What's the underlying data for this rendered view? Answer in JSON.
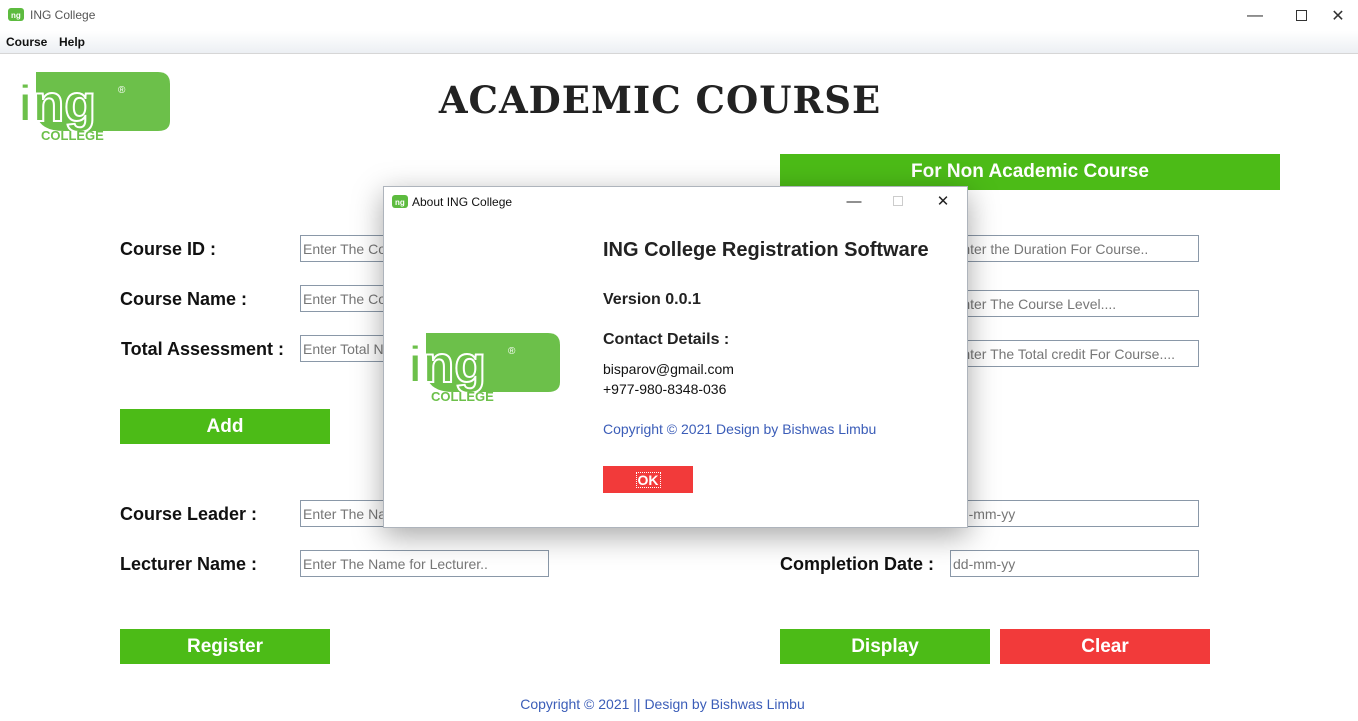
{
  "window": {
    "title": "ING College",
    "icon": "app-icon"
  },
  "menu": {
    "items": [
      "Course",
      "Help"
    ]
  },
  "logo": {
    "text": "ing",
    "subtext": "COLLEGE",
    "mark": "®",
    "color": "#6cc04a"
  },
  "main": {
    "title": "ACADEMIC COURSE",
    "non_academic_banner": "For Non Academic Course"
  },
  "form": {
    "course_id_label": "Course ID :",
    "course_id_placeholder": "Enter The Course ID..",
    "course_name_label": "Course Name :",
    "course_name_placeholder": "Enter The Course Name..",
    "total_assessment_label": "Total Assessment :",
    "total_assessment_placeholder": "Enter Total No. of Assessment..",
    "duration_placeholder": "Enter the Duration For Course..",
    "level_placeholder": "Enter The Course Level....",
    "credit_placeholder": "Enter The Total credit For Course....",
    "add_label": "Add",
    "course_leader_label": "Course Leader :",
    "course_leader_placeholder": "Enter The Name for Course Leader..",
    "lecturer_name_label": "Lecturer Name :",
    "lecturer_name_placeholder": "Enter The Name for Lecturer..",
    "start_date_placeholder": "dd-mm-yy",
    "completion_date_label": "Completion Date :",
    "completion_date_placeholder": "dd-mm-yy",
    "register_label": "Register",
    "display_label": "Display",
    "clear_label": "Clear"
  },
  "footer": {
    "text": "Copyright © 2021 || Design by Bishwas Limbu"
  },
  "dialog": {
    "title": "About ING College",
    "heading": "ING College Registration Software",
    "version": "Version 0.0.1",
    "contact_heading": "Contact Details :",
    "email": "bisparov@gmail.com",
    "phone": "+977-980-8348-036",
    "copyright": "Copyright © 2021 Design by Bishwas Limbu",
    "ok_label": "OK"
  },
  "colors": {
    "green": "#4cbb17",
    "red": "#f23a3a",
    "link_blue": "#3b5db8"
  }
}
